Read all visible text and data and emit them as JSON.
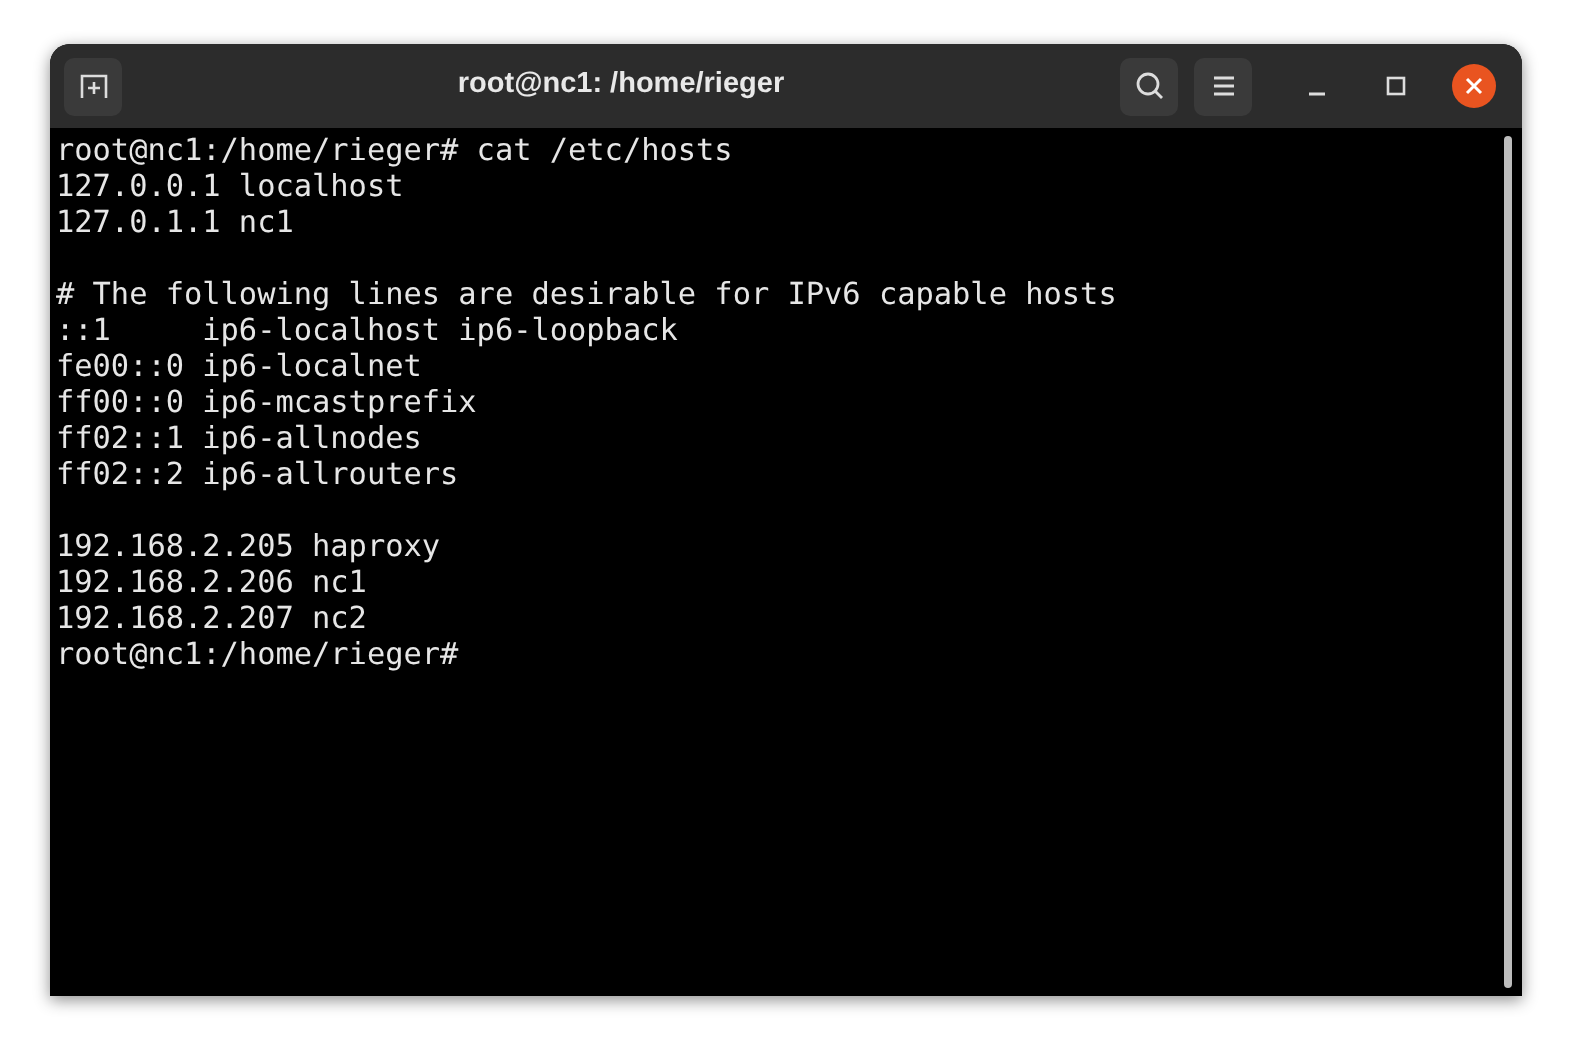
{
  "window": {
    "title": "root@nc1: /home/rieger"
  },
  "terminal": {
    "blocks": [
      [
        "root@nc1:/home/rieger# cat /etc/hosts",
        "127.0.0.1 localhost",
        "127.0.1.1 nc1"
      ],
      [
        "# The following lines are desirable for IPv6 capable hosts",
        "::1     ip6-localhost ip6-loopback",
        "fe00::0 ip6-localnet",
        "ff00::0 ip6-mcastprefix",
        "ff02::1 ip6-allnodes",
        "ff02::2 ip6-allrouters"
      ],
      [
        "192.168.2.205 haproxy",
        "192.168.2.206 nc1",
        "192.168.2.207 nc2",
        "root@nc1:/home/rieger#"
      ]
    ]
  }
}
